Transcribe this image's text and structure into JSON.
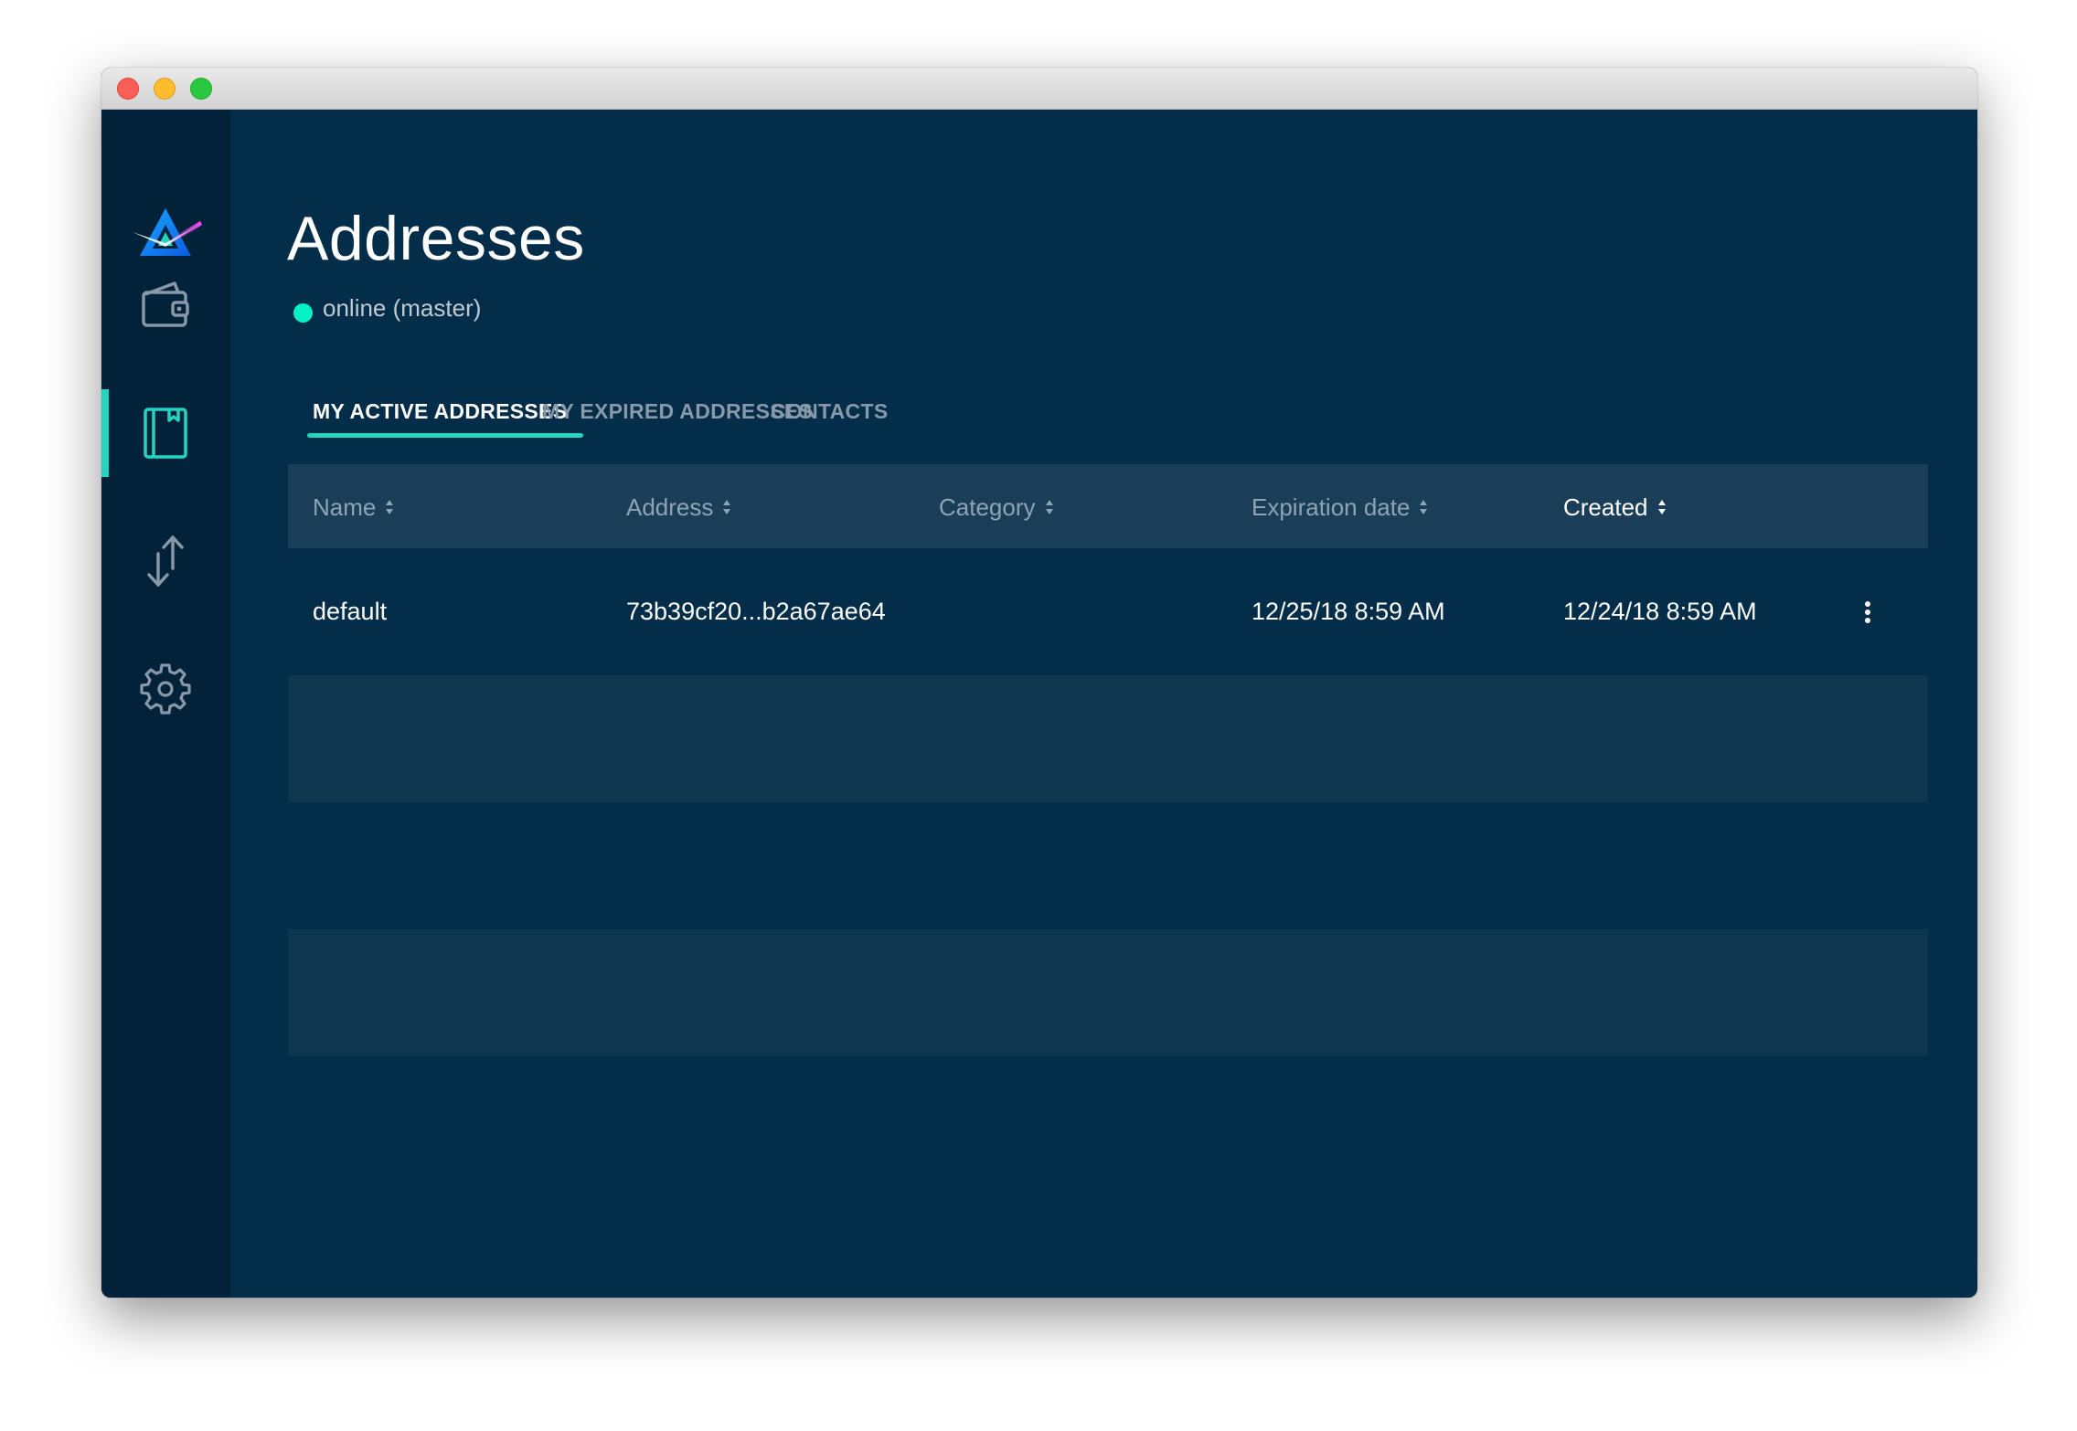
{
  "window": {
    "controls": [
      "close",
      "minimize",
      "maximize"
    ]
  },
  "sidebar": {
    "logo": "beam-logo",
    "items": [
      {
        "name": "wallet",
        "icon": "wallet-icon",
        "active": false
      },
      {
        "name": "addresses",
        "icon": "address-book-icon",
        "active": true
      },
      {
        "name": "utxo",
        "icon": "transfer-arrows-icon",
        "active": false
      },
      {
        "name": "settings",
        "icon": "gear-icon",
        "active": false
      }
    ]
  },
  "header": {
    "title": "Addresses",
    "status": "online (master)",
    "status_color": "#00f1c8"
  },
  "tabs": [
    {
      "label": "MY ACTIVE ADDRESSES",
      "active": true
    },
    {
      "label": "MY EXPIRED ADDRESSES",
      "active": false
    },
    {
      "label": "CONTACTS",
      "active": false
    }
  ],
  "table": {
    "columns": [
      {
        "label": "Name",
        "sortable": true,
        "active": false
      },
      {
        "label": "Address",
        "sortable": true,
        "active": false
      },
      {
        "label": "Category",
        "sortable": true,
        "active": false
      },
      {
        "label": "Expiration date",
        "sortable": true,
        "active": false
      },
      {
        "label": "Created",
        "sortable": true,
        "active": true
      }
    ],
    "rows": [
      {
        "name": "default",
        "address": "73b39cf20...b2a67ae64",
        "category": "",
        "expiration": "12/25/18 8:59 AM",
        "created": "12/24/18 8:59 AM"
      }
    ]
  },
  "colors": {
    "accent": "#24d3c0",
    "background": "#032d48",
    "sidebar": "#02223a",
    "header_row": "#1a3e58",
    "alt_row": "#0f364f"
  }
}
